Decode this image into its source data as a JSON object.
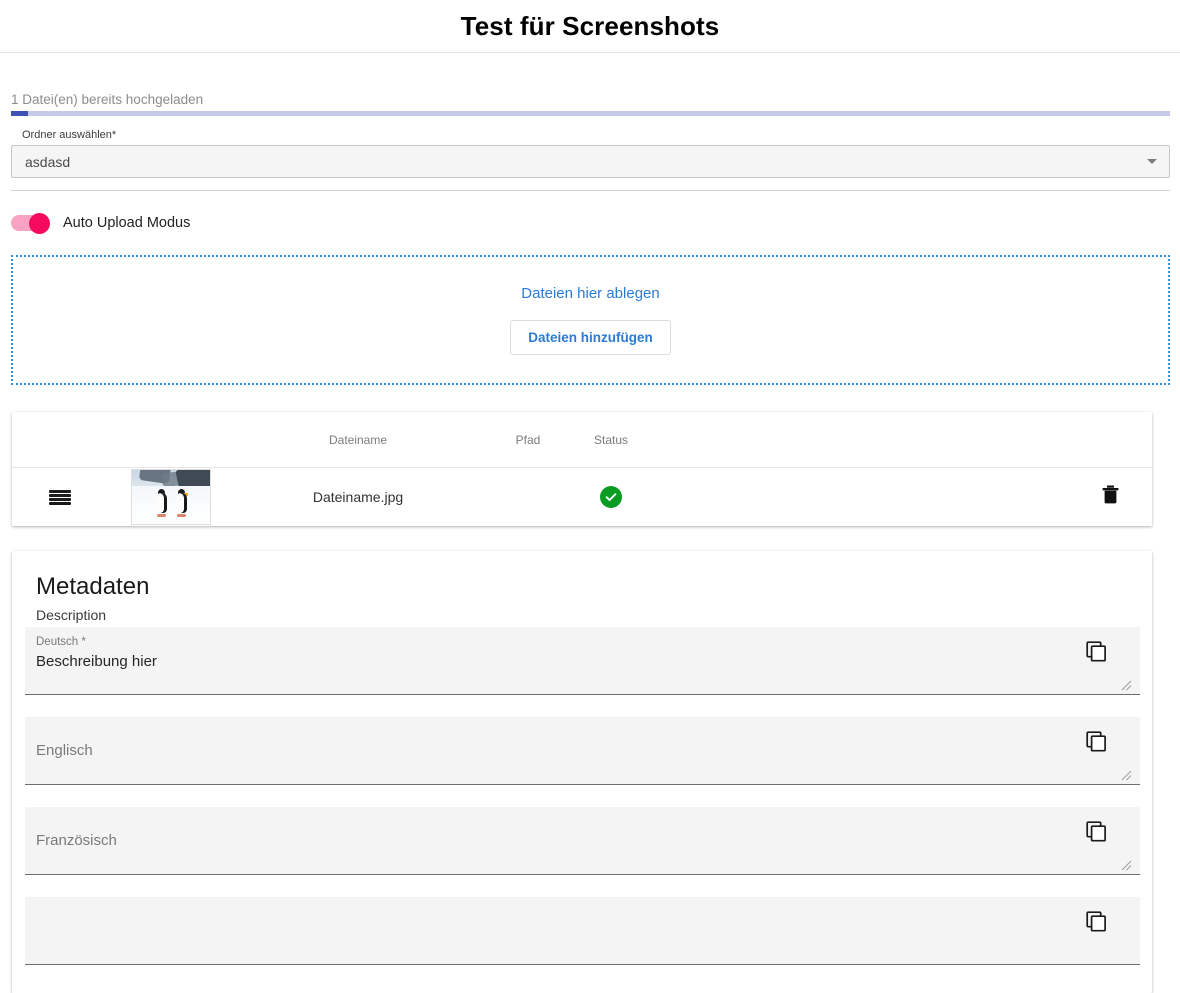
{
  "header": {
    "title": "Test für Screenshots"
  },
  "upload": {
    "progress_label": "1 Datei(en) bereits hochgeladen",
    "progress_percent": 1.5,
    "folder_select": {
      "label": "Ordner auswählen*",
      "value": "asdasd",
      "caret_icon": "chevron-down-icon"
    },
    "auto_upload": {
      "label": "Auto Upload Modus",
      "enabled": true,
      "on_color": "#f50a60",
      "track_color": "#f9a3c2"
    },
    "dropzone": {
      "text": "Dateien hier ablegen",
      "button_label": "Dateien hinzufügen",
      "accent_color": "#2b7bd4"
    }
  },
  "file_table": {
    "columns": [
      "",
      "",
      "Dateiname",
      "Pfad",
      "Status",
      "",
      ""
    ],
    "headers": {
      "filename": "Dateiname",
      "path": "Pfad",
      "status": "Status"
    },
    "rows": [
      {
        "handle_icon": "drag-handle-icon",
        "thumbnail_alt": "penguins-thumbnail",
        "filename": "Dateiname.jpg",
        "path": "",
        "status_icon": "check-circle-icon",
        "status_color": "#0a9b23",
        "delete_icon": "trash-icon"
      }
    ]
  },
  "metadata": {
    "title": "Metadaten",
    "section_label": "Description",
    "fields": [
      {
        "label": "Deutsch *",
        "value": "Beschreibung hier",
        "placeholder": "",
        "copy_icon": "copy-icon",
        "required": true
      },
      {
        "label": "",
        "value": "",
        "placeholder": "Englisch",
        "copy_icon": "copy-icon",
        "required": false
      },
      {
        "label": "",
        "value": "",
        "placeholder": "Französisch",
        "copy_icon": "copy-icon",
        "required": false
      },
      {
        "label": "",
        "value": "",
        "placeholder": "",
        "copy_icon": "copy-icon",
        "required": false
      }
    ]
  }
}
